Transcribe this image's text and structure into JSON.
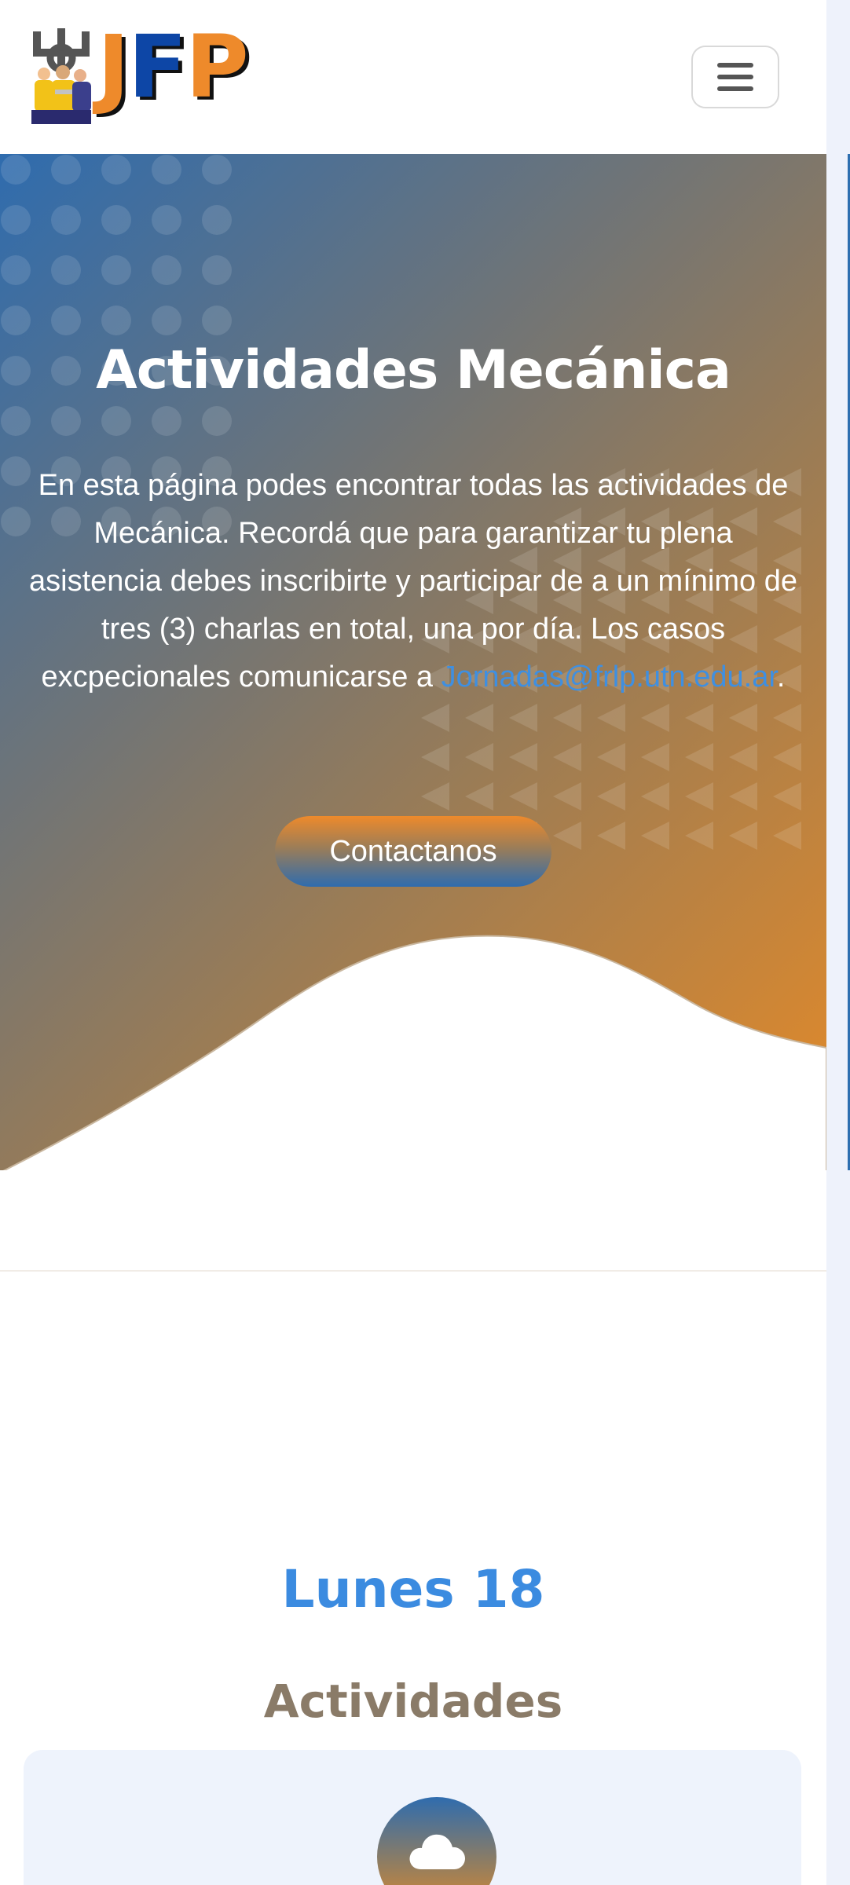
{
  "header": {
    "logo_text": "JFP",
    "logo_letters": [
      "J",
      "F",
      "P"
    ],
    "logo_alt": "JFP logo"
  },
  "hero": {
    "title": "Actividades Mecánica",
    "text": "En esta página podes encontrar todas las actividades de Mecánica. Recordá que para garantizar tu plena asistencia debes inscribirte y participar de a un mínimo de tres (3) charlas en total, una por día. Los casos excpecionales comunicarse a",
    "email": "Jornadas@frlp.utn.edu.ar",
    "email_suffix": ".",
    "cta_label": "Contactanos"
  },
  "schedule": {
    "day_title": "Lunes 18",
    "section_title": "Actividades",
    "card_icon": "cloud-icon"
  },
  "colors": {
    "brand_blue": "#2f6cae",
    "brand_orange": "#e48a28",
    "link_blue": "#3f8fe0",
    "logo_navy": "#0d46a6"
  }
}
